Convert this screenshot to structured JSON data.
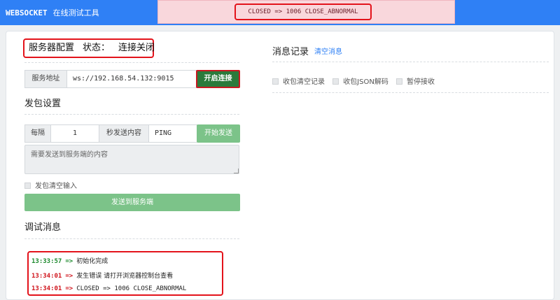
{
  "navbar": {
    "brand": "WEBSOCKET",
    "subtitle": "在线测试工具",
    "alert": "CLOSED => 1006 CLOSE_ABNORMAL"
  },
  "colors": {
    "navbar": "#2f80f5",
    "alert_bg": "#f9d7dc",
    "success": "#1d8a2e",
    "error": "#d0141c",
    "connect_button": "#2b7a3b",
    "send_button": "#7cc389",
    "highlight_border": "#e3131b"
  },
  "server": {
    "title": "服务器配置",
    "status_label": "状态：",
    "status_value": "连接关闭",
    "address_label": "服务地址",
    "address_value": "ws://192.168.54.132:9015",
    "connect_button": "开启连接"
  },
  "send": {
    "title": "发包设置",
    "every_label": "每隔",
    "interval_value": "1",
    "unit_label": "秒发送内容",
    "content_value": "PING",
    "start_button": "开始发送",
    "message_placeholder": "需要发送到服务端的内容",
    "clear_input_label": "发包清空输入",
    "submit_button": "发送到服务端"
  },
  "debug": {
    "title": "调试消息",
    "entries": [
      {
        "time": "13:33:57",
        "arrow": "=>",
        "message": "初始化完成",
        "level": "ok"
      },
      {
        "time": "13:34:01",
        "arrow": "=>",
        "message": "发生错误 请打开浏览器控制台查看",
        "level": "err"
      },
      {
        "time": "13:34:01",
        "arrow": "=>",
        "message": "CLOSED => 1006 CLOSE_ABNORMAL",
        "level": "err"
      }
    ]
  },
  "messages": {
    "title": "消息记录",
    "clear_link": "清空消息",
    "options": [
      "收包清空记录",
      "收包JSON解码",
      "暂停接收"
    ]
  }
}
